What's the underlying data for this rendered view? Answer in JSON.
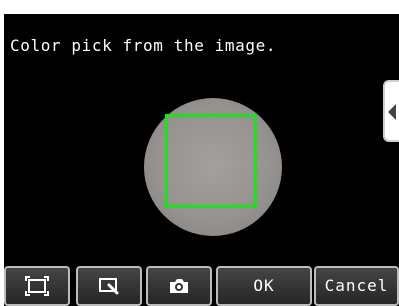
{
  "prompt": {
    "text": "Color pick from the image."
  },
  "toolbar": {
    "fit_icon": "fit-screen-icon",
    "zoom_icon": "zoom-icon",
    "camera_icon": "camera-icon",
    "ok_label": "OK",
    "cancel_label": "Cancel"
  },
  "colors": {
    "screen_background": "#000000",
    "roi_border": "#1fe01f",
    "sample_disc": "#9a9694",
    "button_border": "#bcbcbc"
  }
}
